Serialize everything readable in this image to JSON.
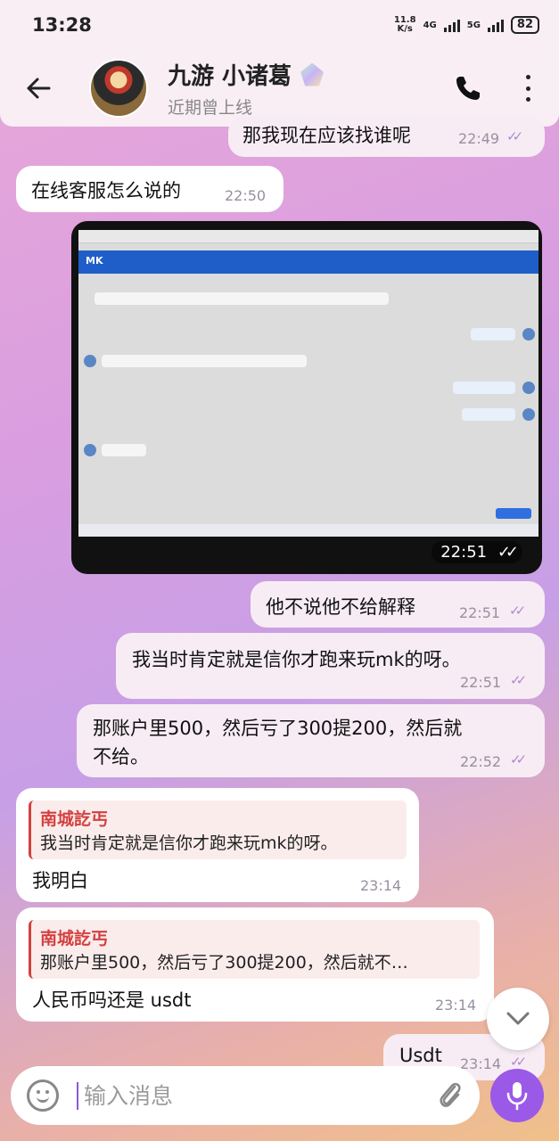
{
  "status": {
    "time": "13:28",
    "net_speed_top": "11.8",
    "net_speed_bottom": "K/s",
    "net1": "4G",
    "net2": "5G",
    "battery": "82"
  },
  "header": {
    "title": "九游 小诸葛",
    "subtitle": "近期曾上线"
  },
  "messages": {
    "m0": {
      "text": "那我现在应该找谁呢",
      "time": "22:49"
    },
    "m1": {
      "text": "在线客服怎么说的",
      "time": "22:50"
    },
    "photo": {
      "time": "22:51"
    },
    "m2": {
      "text": "他不说他不给解释",
      "time": "22:51"
    },
    "m3": {
      "text": "我当时肯定就是信你才跑来玩mk的呀。",
      "time": "22:51"
    },
    "m4": {
      "line1": "那账户里500，然后亏了300提200，然后就",
      "line2": "不给。",
      "time": "22:52"
    },
    "m5": {
      "reply_name": "南城訖丐",
      "reply_text": "我当时肯定就是信你才跑来玩mk的呀。",
      "text": "我明白",
      "time": "23:14"
    },
    "m6": {
      "reply_name": "南城訖丐",
      "reply_text": "那账户里500，然后亏了300提200，然后就不…",
      "text": "人民币吗还是 usdt",
      "time": "23:14"
    },
    "m7": {
      "text": "Usdt",
      "time": "23:14"
    }
  },
  "input": {
    "placeholder": "输入消息"
  },
  "colors": {
    "accent": "#9b59e8",
    "reply": "#d43f3f",
    "outgoing": "#f7ecf4",
    "incoming": "#ffffff"
  }
}
